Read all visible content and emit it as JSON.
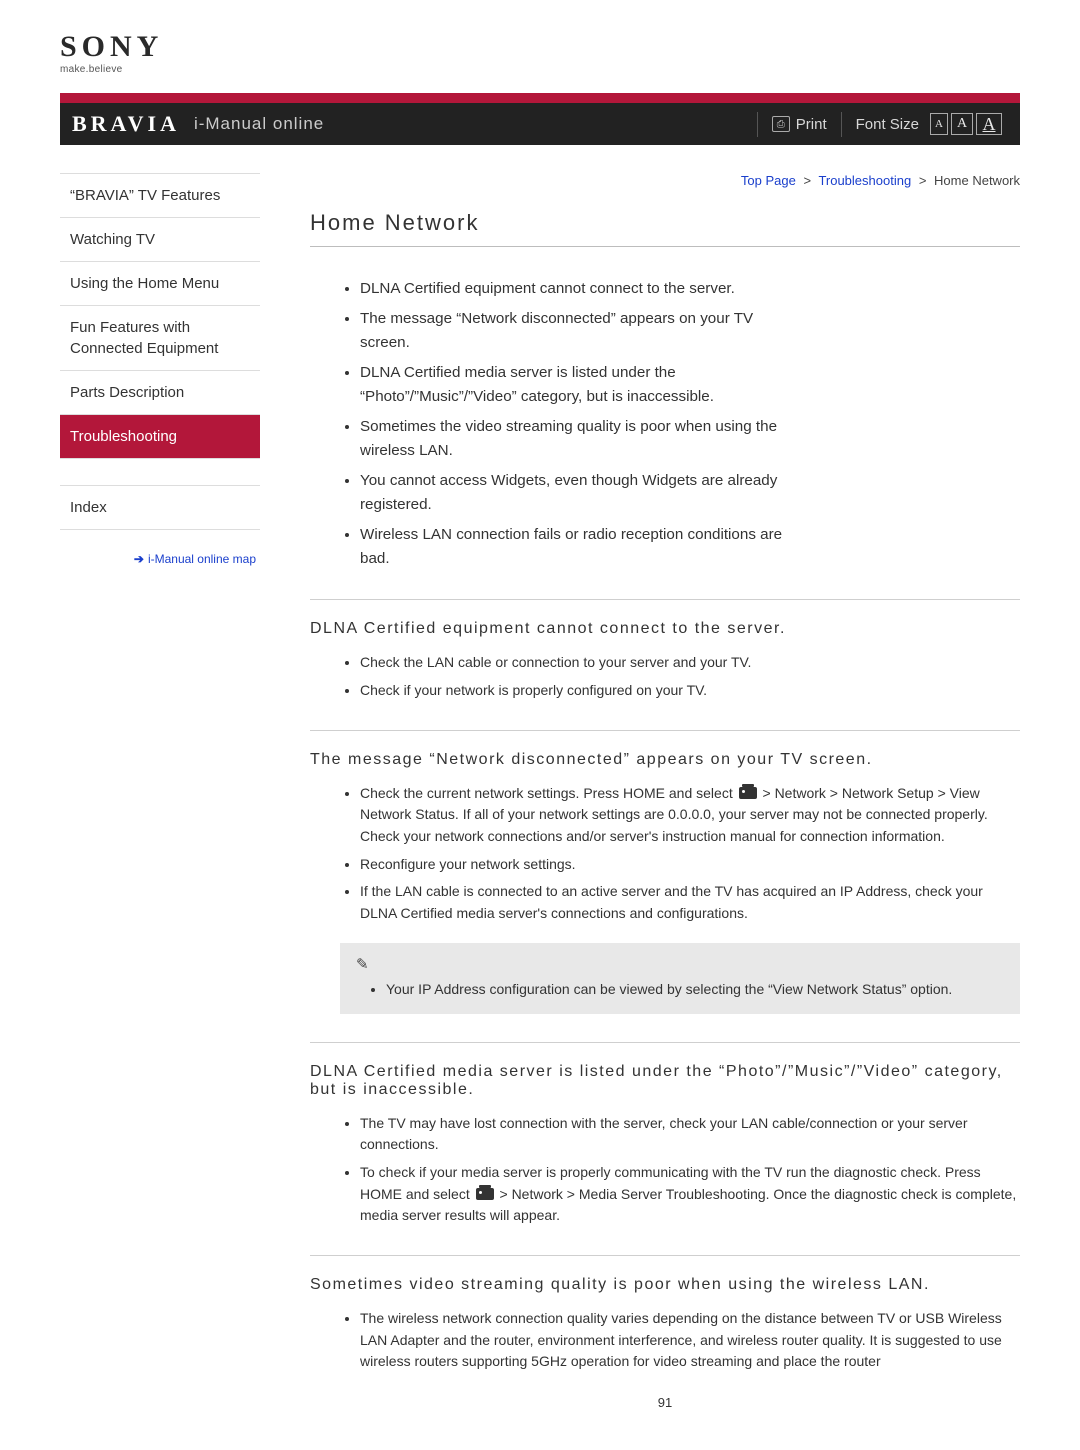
{
  "brand": {
    "name": "SONY",
    "tagline": "make.believe"
  },
  "header": {
    "bravia": "BRAVIA",
    "subtitle": "i-Manual online",
    "print": "Print",
    "font_size_label": "Font Size",
    "font_a": "A"
  },
  "breadcrumb": {
    "top": "Top Page",
    "mid": "Troubleshooting",
    "leaf": "Home Network",
    "sep": ">"
  },
  "sidebar": {
    "items": [
      "“BRAVIA” TV Features",
      "Watching TV",
      "Using the Home Menu",
      "Fun Features with Connected Equipment",
      "Parts Description",
      "Troubleshooting"
    ],
    "index": "Index",
    "map_link": "i-Manual online map"
  },
  "page": {
    "title": "Home Network",
    "page_number": "91"
  },
  "intro": [
    "DLNA Certified equipment cannot connect to the server.",
    "The message “Network disconnected” appears on your TV screen.",
    "DLNA Certified media server is listed under the “Photo”/”Music”/”Video” category, but is inaccessible.",
    "Sometimes the video streaming quality is poor when using the wireless LAN.",
    "You cannot access Widgets, even though Widgets are already registered.",
    "Wireless LAN connection fails or radio reception conditions are bad."
  ],
  "sections": [
    {
      "heading": "DLNA Certified equipment cannot connect to the server.",
      "bullets": [
        "Check the LAN cable or connection to your server and your TV.",
        "Check if your network is properly configured on your TV."
      ]
    },
    {
      "heading": "The message “Network disconnected” appears on your TV screen.",
      "bullets": [
        "Check the current network settings. Press HOME and select {icon} > Network > Network Setup > View Network Status. If all of your network settings are 0.0.0.0, your server may not be connected properly. Check your network connections and/or server's instruction manual for connection information.",
        "Reconfigure your network settings.",
        "If the LAN cable is connected to an active server and the TV has acquired an IP Address, check your DLNA Certified media server's connections and configurations."
      ],
      "note": "Your IP Address configuration can be viewed by selecting the “View Network Status” option."
    },
    {
      "heading": "DLNA Certified media server is listed under the “Photo”/”Music”/”Video” category, but is inaccessible.",
      "bullets": [
        "The TV may have lost connection with the server, check your LAN cable/connection or your server connections.",
        "To check if your media server is properly communicating with the TV run the diagnostic check. Press HOME and select {icon} > Network > Media Server Troubleshooting. Once the diagnostic check is complete, media server results will appear."
      ]
    },
    {
      "heading": "Sometimes video streaming quality is poor when using the wireless LAN.",
      "bullets": [
        "The wireless network connection quality varies depending on the distance between TV or USB Wireless LAN Adapter and the router, environment interference, and wireless router quality. It is suggested to use wireless routers supporting 5GHz operation for video streaming and place the router"
      ]
    }
  ]
}
